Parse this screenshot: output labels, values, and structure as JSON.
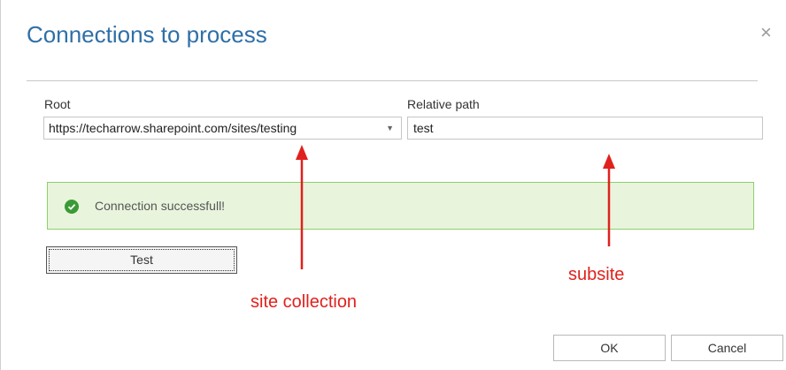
{
  "dialog": {
    "title": "Connections to process",
    "close_glyph": "×"
  },
  "form": {
    "root_label": "Root",
    "root_value": "https://techarrow.sharepoint.com/sites/testing",
    "relative_path_label": "Relative path",
    "relative_path_value": "test"
  },
  "status": {
    "message": "Connection successfull!",
    "icon": "check-circle-icon",
    "color": "#3a9a36"
  },
  "buttons": {
    "test": "Test",
    "ok": "OK",
    "cancel": "Cancel"
  },
  "annotations": {
    "site_collection": "site collection",
    "subsite": "subsite",
    "color": "#e0211d"
  }
}
